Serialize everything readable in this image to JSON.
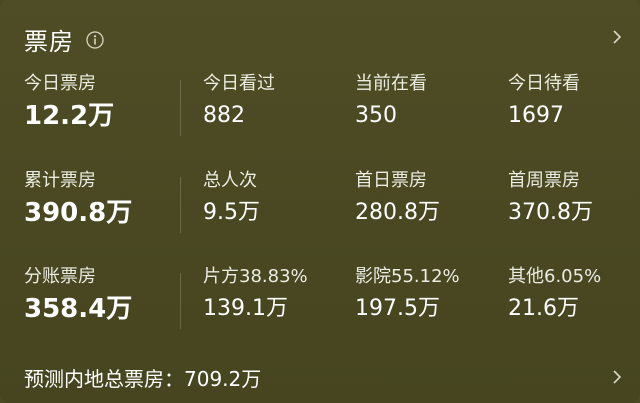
{
  "header": {
    "title": "票房"
  },
  "rows": [
    {
      "cells": [
        {
          "label": "今日票房",
          "value": "12.2万"
        },
        {
          "label": "今日看过",
          "value": "882"
        },
        {
          "label": "当前在看",
          "value": "350"
        },
        {
          "label": "今日待看",
          "value": "1697"
        }
      ]
    },
    {
      "cells": [
        {
          "label": "累计票房",
          "value": "390.8万"
        },
        {
          "label": "总人次",
          "value": "9.5万"
        },
        {
          "label": "首日票房",
          "value": "280.8万"
        },
        {
          "label": "首周票房",
          "value": "370.8万"
        }
      ]
    },
    {
      "cells": [
        {
          "label": "分账票房",
          "value": "358.4万"
        },
        {
          "label": "片方38.83%",
          "value": "139.1万"
        },
        {
          "label": "影院55.12%",
          "value": "197.5万"
        },
        {
          "label": "其他6.05%",
          "value": "21.6万"
        }
      ]
    }
  ],
  "footer": {
    "text": "预测内地总票房：709.2万"
  },
  "colors": {
    "background": "#4b4a22",
    "text": "#ffffff"
  },
  "icons": {
    "info": "info-circle-icon",
    "chevron": "chevron-right-icon"
  }
}
